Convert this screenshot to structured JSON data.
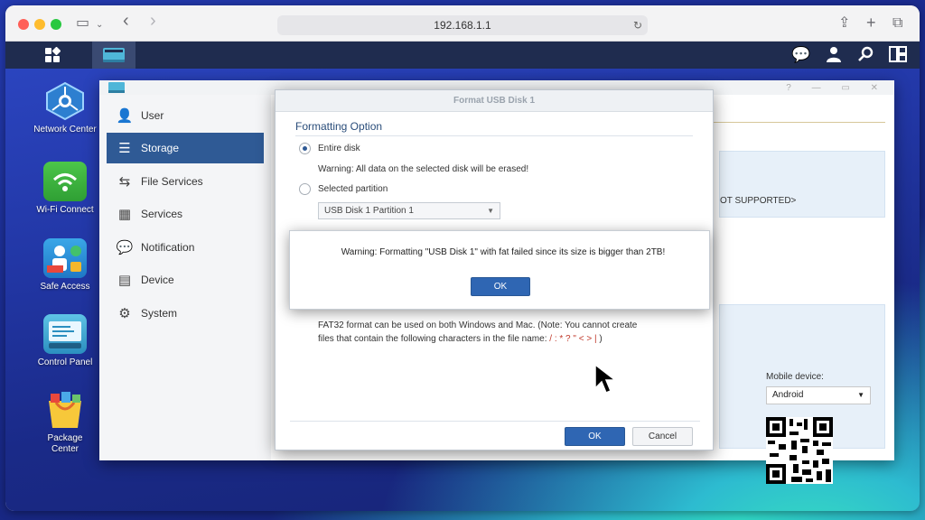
{
  "browser": {
    "url": "192.168.1.1"
  },
  "desktop": {
    "icons": [
      {
        "label_line1": "Network Center",
        "label_line2": ""
      },
      {
        "label_line1": "Wi-Fi Connect",
        "label_line2": ""
      },
      {
        "label_line1": "Safe Access",
        "label_line2": ""
      },
      {
        "label_line1": "Control Panel",
        "label_line2": ""
      },
      {
        "label_line1": "Package",
        "label_line2": "Center"
      }
    ]
  },
  "control_panel": {
    "sidebar": [
      {
        "label": "User",
        "icon": "user-icon"
      },
      {
        "label": "Storage",
        "icon": "storage-icon"
      },
      {
        "label": "File Services",
        "icon": "file-services-icon"
      },
      {
        "label": "Services",
        "icon": "services-icon"
      },
      {
        "label": "Notification",
        "icon": "notification-icon"
      },
      {
        "label": "Device",
        "icon": "device-icon"
      },
      {
        "label": "System",
        "icon": "system-icon"
      }
    ],
    "active_item": "Storage",
    "background_text": {
      "not_supported": "OT SUPPORTED>",
      "mobile_label": "Mobile device:",
      "mobile_value": "Android"
    }
  },
  "format_dialog": {
    "title": "Format USB Disk 1",
    "section_title": "Formatting Option",
    "option_entire": "Entire disk",
    "warning_erase": "Warning: All data on the selected disk will be erased!",
    "option_partition": "Selected partition",
    "partition_value": "USB Disk 1 Partition 1",
    "fat32_line1": "FAT32 format can be used on both Windows and Mac. (Note: You cannot create",
    "fat32_line2_prefix": "files that contain the following characters in the file name:",
    "fat32_chars": "/ : * ? \" < > |",
    "fat32_suffix": ")",
    "ok_label": "OK",
    "cancel_label": "Cancel"
  },
  "alert": {
    "message": "Warning: Formatting \"USB Disk 1\" with fat failed since its size is bigger than 2TB!",
    "ok_label": "OK"
  },
  "colors": {
    "accent": "#2f5a95",
    "primary_button": "#2f66b3",
    "danger_chars": "#c0392b"
  }
}
